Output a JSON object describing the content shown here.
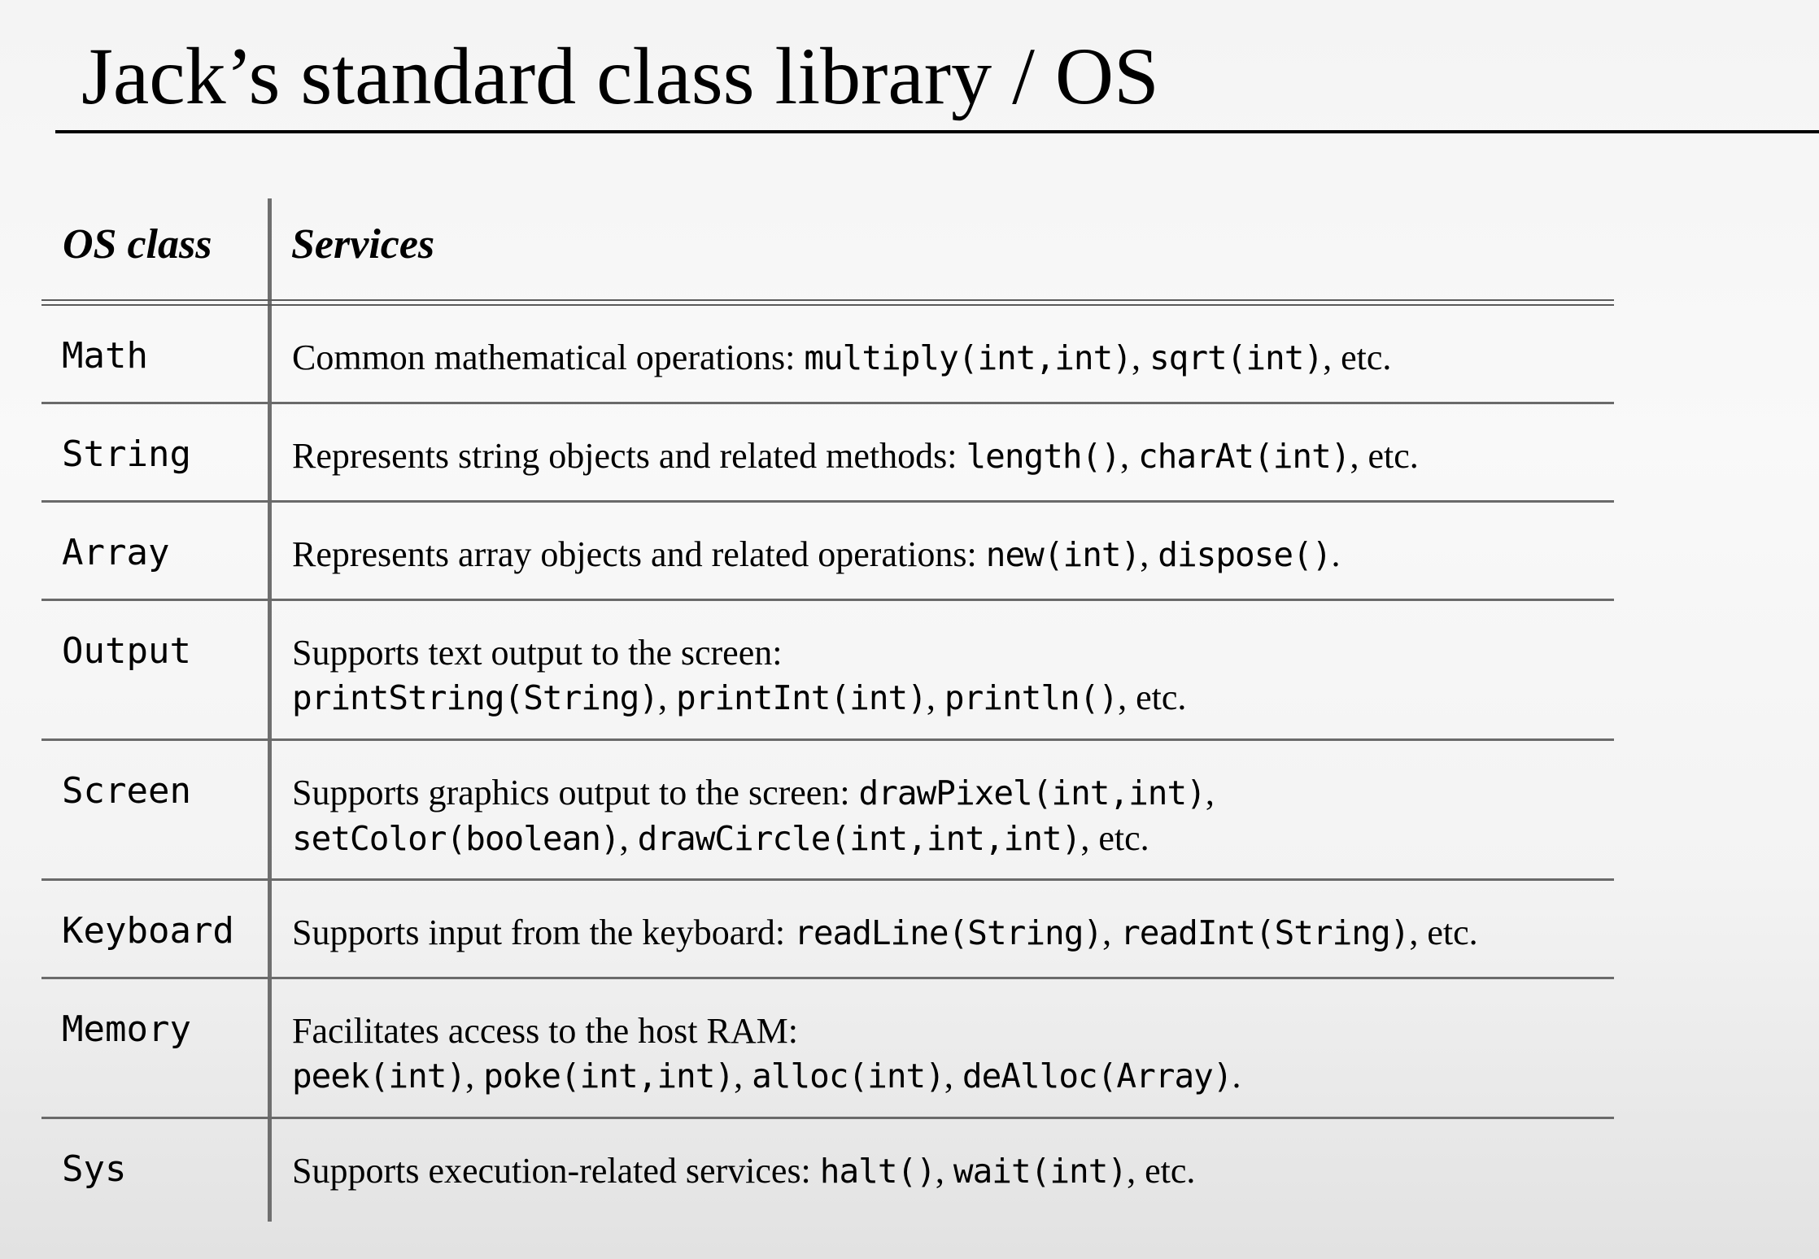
{
  "slide": {
    "title": "Jack’s standard class library / OS"
  },
  "table": {
    "headers": {
      "os_class": "OS class",
      "services": "Services"
    },
    "rows": [
      {
        "class_name": "Math",
        "lines": [
          [
            {
              "t": "Common mathematical operations: ",
              "m": false
            },
            {
              "t": "multiply(int,int)",
              "m": true
            },
            {
              "t": ", ",
              "m": false
            },
            {
              "t": "sqrt(int)",
              "m": true
            },
            {
              "t": ", etc.",
              "m": false
            }
          ]
        ]
      },
      {
        "class_name": "String",
        "lines": [
          [
            {
              "t": "Represents string objects and related methods: ",
              "m": false
            },
            {
              "t": "length()",
              "m": true
            },
            {
              "t": ", ",
              "m": false
            },
            {
              "t": "charAt(int)",
              "m": true
            },
            {
              "t": ", etc.",
              "m": false
            }
          ]
        ]
      },
      {
        "class_name": "Array",
        "lines": [
          [
            {
              "t": "Represents array objects and related operations: ",
              "m": false
            },
            {
              "t": "new(int)",
              "m": true
            },
            {
              "t": ", ",
              "m": false
            },
            {
              "t": "dispose()",
              "m": true
            },
            {
              "t": ".",
              "m": false
            }
          ]
        ]
      },
      {
        "class_name": "Output",
        "lines": [
          [
            {
              "t": "Supports text output to the screen:",
              "m": false
            }
          ],
          [
            {
              "t": "printString(String)",
              "m": true
            },
            {
              "t": ", ",
              "m": false
            },
            {
              "t": "printInt(int)",
              "m": true
            },
            {
              "t": ", ",
              "m": false
            },
            {
              "t": "println()",
              "m": true
            },
            {
              "t": ", etc.",
              "m": false
            }
          ]
        ]
      },
      {
        "class_name": "Screen",
        "lines": [
          [
            {
              "t": "Supports graphics output to the screen: ",
              "m": false
            },
            {
              "t": "drawPixel(int,int)",
              "m": true
            },
            {
              "t": ",",
              "m": false
            }
          ],
          [
            {
              "t": "setColor(boolean)",
              "m": true
            },
            {
              "t": ", ",
              "m": false
            },
            {
              "t": "drawCircle(int,int,int)",
              "m": true
            },
            {
              "t": ", etc.",
              "m": false
            }
          ]
        ]
      },
      {
        "class_name": "Keyboard",
        "lines": [
          [
            {
              "t": "Supports input from the keyboard: ",
              "m": false
            },
            {
              "t": "readLine(String)",
              "m": true
            },
            {
              "t": ", ",
              "m": false
            },
            {
              "t": "readInt(String)",
              "m": true
            },
            {
              "t": ", etc.",
              "m": false
            }
          ]
        ]
      },
      {
        "class_name": "Memory",
        "lines": [
          [
            {
              "t": "Facilitates access to the host RAM:",
              "m": false
            }
          ],
          [
            {
              "t": "peek(int)",
              "m": true
            },
            {
              "t": ", ",
              "m": false
            },
            {
              "t": "poke(int,int)",
              "m": true
            },
            {
              "t": ", ",
              "m": false
            },
            {
              "t": "alloc(int)",
              "m": true
            },
            {
              "t": ", ",
              "m": false
            },
            {
              "t": "deAlloc(Array)",
              "m": true
            },
            {
              "t": ".",
              "m": false
            }
          ]
        ]
      },
      {
        "class_name": "Sys",
        "lines": [
          [
            {
              "t": "Supports execution-related services: ",
              "m": false
            },
            {
              "t": "halt()",
              "m": true
            },
            {
              "t": ", ",
              "m": false
            },
            {
              "t": "wait(int)",
              "m": true
            },
            {
              "t": ", etc.",
              "m": false
            }
          ]
        ]
      }
    ]
  }
}
